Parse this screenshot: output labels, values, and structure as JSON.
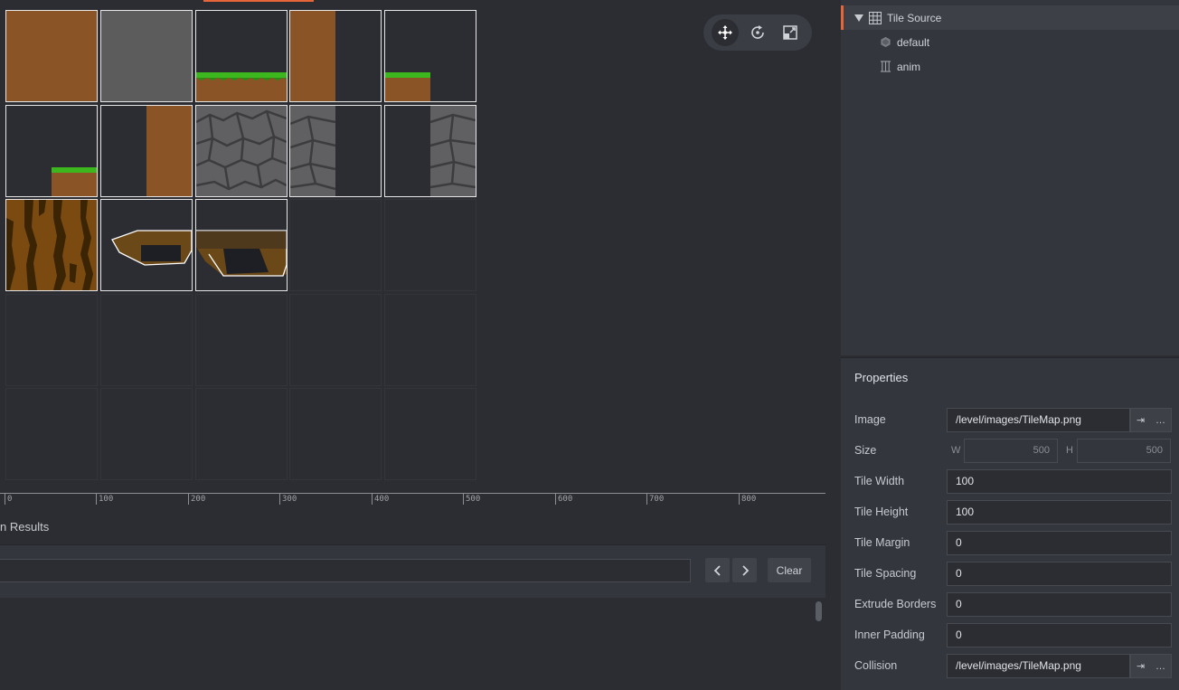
{
  "colors": {
    "accent": "#e8653a",
    "dirt": "#8a5426",
    "grass": "#3cb81e",
    "stone": "#5a5a5a",
    "cobble": "#606062",
    "bark": "#5a3a08"
  },
  "toolbar": {
    "move_icon": "move-icon",
    "rotate_icon": "rotate-icon",
    "scale_icon": "scale-icon"
  },
  "ruler": {
    "ticks": [
      "0",
      "100",
      "200",
      "300",
      "400",
      "500",
      "600",
      "700",
      "800"
    ]
  },
  "bottom_panel": {
    "tab_label": "n Results",
    "search_value": "",
    "prev_icon": "chevron-left-icon",
    "next_icon": "chevron-right-icon",
    "clear_label": "Clear"
  },
  "outline": {
    "root": {
      "label": "Tile Source",
      "icon": "grid-icon"
    },
    "children": [
      {
        "label": "default",
        "icon": "hexagon-icon"
      },
      {
        "label": "anim",
        "icon": "film-icon"
      }
    ]
  },
  "properties": {
    "title": "Properties",
    "image": {
      "label": "Image",
      "value": "/level/images/TileMap.png"
    },
    "size": {
      "label": "Size",
      "w_label": "W",
      "w": "500",
      "h_label": "H",
      "h": "500"
    },
    "tile_width": {
      "label": "Tile Width",
      "value": "100"
    },
    "tile_height": {
      "label": "Tile Height",
      "value": "100"
    },
    "tile_margin": {
      "label": "Tile Margin",
      "value": "0"
    },
    "tile_spacing": {
      "label": "Tile Spacing",
      "value": "0"
    },
    "extrude_borders": {
      "label": "Extrude Borders",
      "value": "0"
    },
    "inner_padding": {
      "label": "Inner Padding",
      "value": "0"
    },
    "collision": {
      "label": "Collision",
      "value": "/level/images/TileMap.png"
    },
    "goto_glyph": "⇥",
    "browse_glyph": "…"
  }
}
